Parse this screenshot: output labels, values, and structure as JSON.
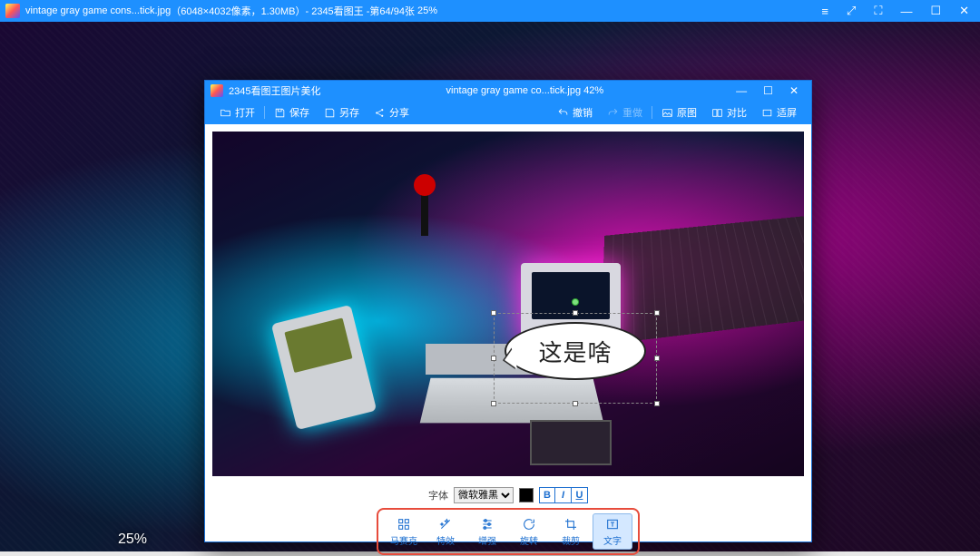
{
  "outer": {
    "filename": "vintage gray game cons...tick.jpg",
    "dimensions": "（6048×4032像素，1.30MB）",
    "app": " - 2345看图王 - ",
    "counter": "第64/94张",
    "zoom": "25%",
    "btn_menu": "≡",
    "btn_scale": "⤢",
    "btn_full": "⛶",
    "btn_min": "—",
    "btn_max": "☐",
    "btn_close": "✕"
  },
  "inner": {
    "title_left": "2345看图王图片美化",
    "title_mid": "vintage gray game co...tick.jpg  42%",
    "btn_min": "—",
    "btn_max": "☐",
    "btn_close": "✕",
    "tb": {
      "open": "打开",
      "save": "保存",
      "saveas": "另存",
      "share": "分享",
      "undo": "撤销",
      "redo": "重做",
      "original": "原图",
      "compare": "对比",
      "fit": "适屏"
    }
  },
  "bubble": {
    "text": "这是啥"
  },
  "fontbar": {
    "label": "字体",
    "font": "微软雅黑",
    "B": "B",
    "I": "I",
    "U": "U"
  },
  "tools": {
    "mosaic": "马赛克",
    "effect": "特效",
    "enhance": "增强",
    "rotate": "旋转",
    "crop": "裁剪",
    "text": "文字"
  },
  "footer_zoom": "25%"
}
